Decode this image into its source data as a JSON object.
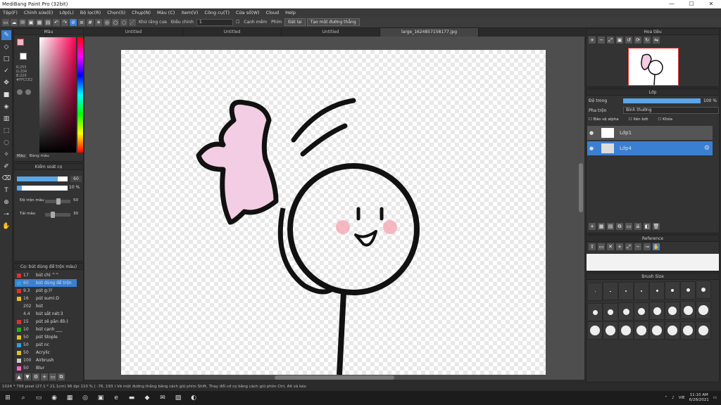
{
  "window": {
    "title": "MediBang Paint Pro (32bit)",
    "minimize": "—",
    "maximize": "☐",
    "close": "✕"
  },
  "menu": [
    "Tệp(F)",
    "Chỉnh sửa(E)",
    "Lớp(L)",
    "Bộ lọc(R)",
    "Chọn(S)",
    "Chụp(N)",
    "Màu (C)",
    "Xem(V)",
    "Công cụ(T)",
    "Cửa sổ(W)",
    "Cloud",
    "Help"
  ],
  "toolbar": {
    "snap_label": "Khử răng cưa",
    "adjust_label": "Điều chỉnh",
    "adjust_value": "1",
    "smooth_label": "Cạnh mềm",
    "key_label": "Phím",
    "undo_label": "Đặt lại",
    "straight_label": "Tạo một đường thẳng"
  },
  "tabs": [
    "Untitled",
    "Untitled",
    "Untitled",
    "large_1624857158177.jpg"
  ],
  "color_panel": {
    "title": "Màu",
    "rgb_r": "R:255",
    "rgb_g": "G:204",
    "rgb_b": "B:220",
    "hex": "#FFCCE2",
    "tab1": "Màu",
    "tab2": "Bảng màu"
  },
  "brush_ctrl": {
    "title": "Kiểm soát cọ",
    "size_value": "60",
    "opacity_value": "10 %",
    "mix_label": "Độ trộn màu",
    "mix_value": "50",
    "reload_label": "Tải màu",
    "reload_value": "30"
  },
  "brush_list": {
    "title": "Cọ: bút dùng để trộn màu)",
    "items": [
      {
        "num": "17",
        "name": "bút chì ^^",
        "color": "#e03030"
      },
      {
        "num": "60",
        "name": "bút dùng để trộn",
        "color": "#2ea0e0",
        "selected": true
      },
      {
        "num": "9.3",
        "name": "pút g:)?",
        "color": "#e03030"
      },
      {
        "num": "16",
        "name": "pút sumi:D",
        "color": "#e0c020"
      },
      {
        "num": "202",
        "name": "bút",
        "color": "#333333"
      },
      {
        "num": "4.4",
        "name": "bút sắt nét:3",
        "color": "#333333"
      },
      {
        "num": "15",
        "name": "pút zê păn đô:)",
        "color": "#e03030"
      },
      {
        "num": "10",
        "name": "bút cạnh ___",
        "color": "#20b020"
      },
      {
        "num": "50",
        "name": "pút Stople",
        "color": "#e0c020"
      },
      {
        "num": "50",
        "name": "pút nc",
        "color": "#2ea0e0"
      },
      {
        "num": "50",
        "name": "Acrylic",
        "color": "#e0c020"
      },
      {
        "num": "100",
        "name": "Airbrush",
        "color": "#cccccc"
      },
      {
        "num": "50",
        "name": "Blur",
        "color": "#ff66cc"
      }
    ]
  },
  "navigator": {
    "title": "Hoa tiêu"
  },
  "layers": {
    "title": "Lớp",
    "opacity_label": "Độ trong",
    "opacity_value": "100 %",
    "blend_label": "Pha trộn",
    "blend_value": "Bình thường",
    "protect_alpha": "Bảo vệ alpha",
    "clip": "Xén bớt",
    "lock": "Khóa",
    "items": [
      "Lớp1",
      "Lớp4"
    ]
  },
  "reference": {
    "title": "Reference"
  },
  "brush_size": {
    "title": "Brush Size"
  },
  "status": "1024 * 799 pixel  (27.1 * 21.1cm)  96 dpi  110 %  ( -76, 193 )  Vẽ một đường thẳng bằng cách giữ phím Shift, Thay đổi cỡ cọ bằng cách giữ phím Ctrl, Alt và kéo",
  "taskbar": {
    "time": "11:10 AM",
    "date": "6/28/2021",
    "lang": "VIE"
  },
  "colors": {
    "accent": "#3b7fd1",
    "pink": "#f3cde3",
    "primary": "#f5b6c6"
  }
}
